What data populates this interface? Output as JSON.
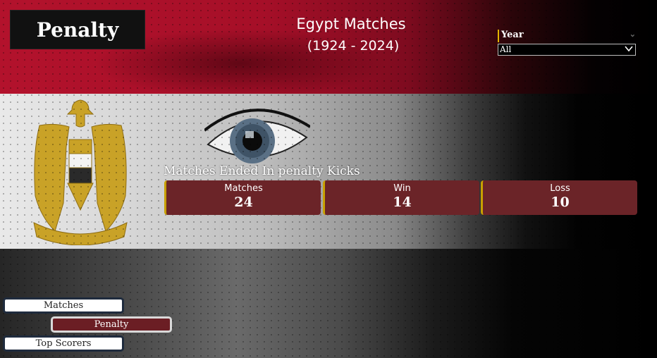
{
  "header": {
    "page_title": "Penalty",
    "title": "Egypt Matches",
    "subtitle": "(1924 - 2024)"
  },
  "filter": {
    "label": "Year",
    "selected": "All"
  },
  "kpis": {
    "heading": "Matches Ended In penalty Kicks",
    "cards": [
      {
        "label": "Matches",
        "value": "24"
      },
      {
        "label": "Win",
        "value": "14"
      },
      {
        "label": "Loss",
        "value": "10"
      }
    ]
  },
  "nav": {
    "matches": "Matches",
    "penalty": "Penalty",
    "top_scorers": "Top  Scorers"
  },
  "icons": {
    "eagle": "egypt-eagle-emblem-icon",
    "dropdown": "chevron-down-icon"
  },
  "colors": {
    "flag_red": "#b3122c",
    "card_bg": "#6b2428",
    "accent": "#c8a000",
    "emblem_gold": "#c9a227"
  }
}
